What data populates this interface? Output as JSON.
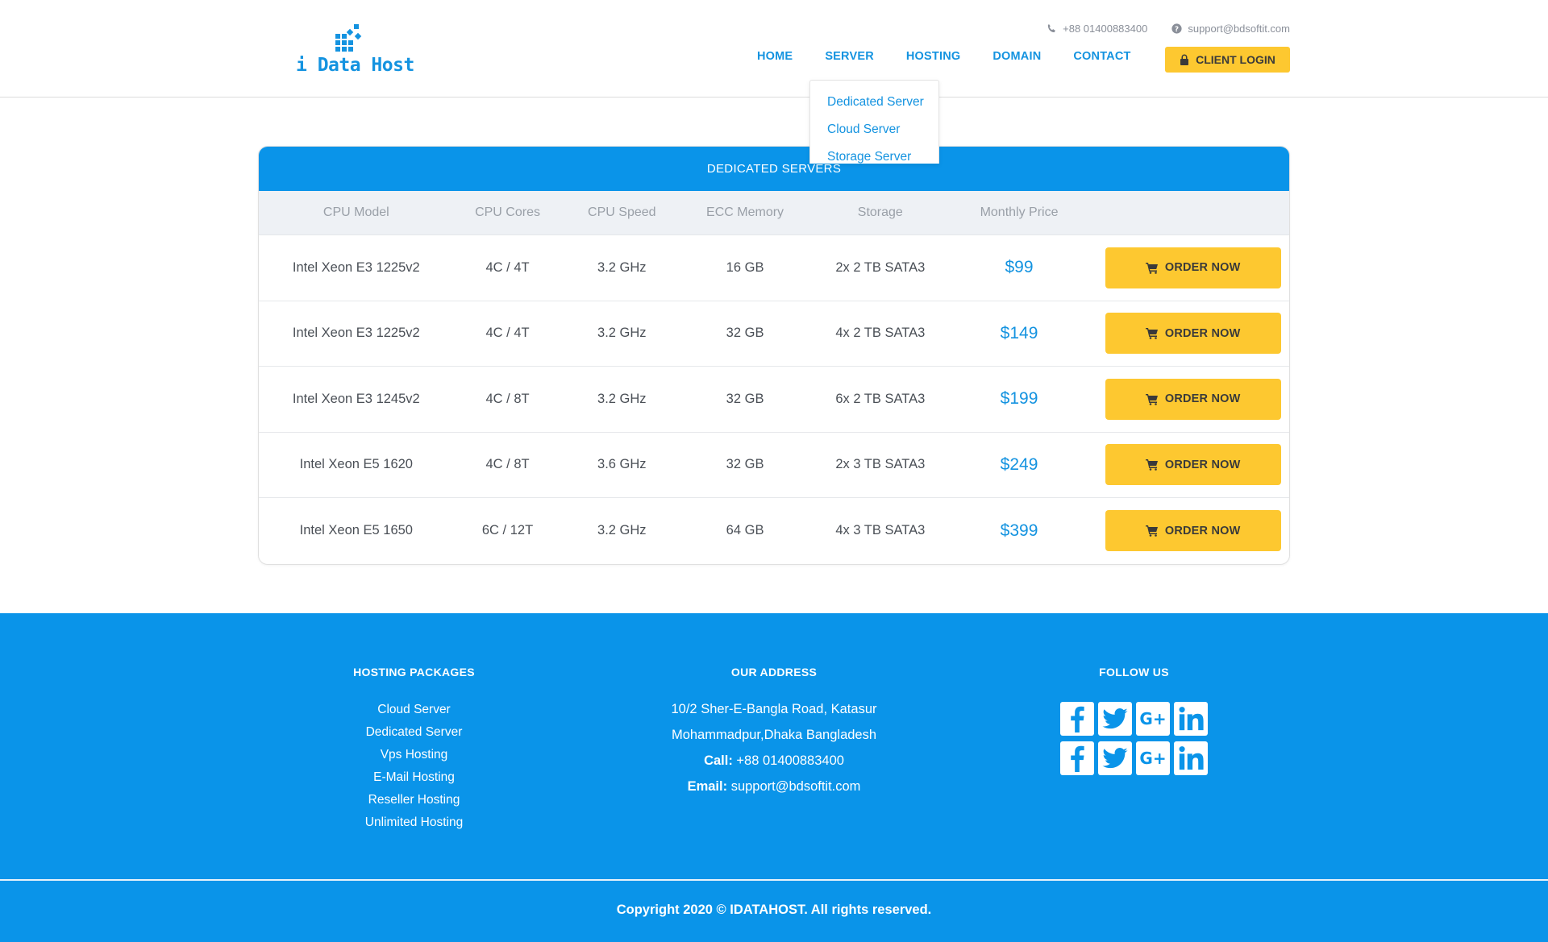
{
  "brand": {
    "name": "i Data Host"
  },
  "topbar": {
    "phone": "+88 01400883400",
    "email": "support@bdsoftit.com"
  },
  "nav": {
    "home": "HOME",
    "server": "SERVER",
    "hosting": "HOSTING",
    "domain": "DOMAIN",
    "contact": "CONTACT",
    "login": "CLIENT LOGIN"
  },
  "server_menu": [
    "Dedicated Server",
    "Cloud Server",
    "Storage Server"
  ],
  "table": {
    "title": "DEDICATED SERVERS",
    "headers": [
      "CPU Model",
      "CPU Cores",
      "CPU Speed",
      "ECC Memory",
      "Storage",
      "Monthly Price"
    ],
    "order_label": "ORDER NOW",
    "rows": [
      {
        "cpu": "Intel Xeon E3 1225v2",
        "cores": "4C / 4T",
        "speed": "3.2 GHz",
        "memory": "16 GB",
        "storage": "2x 2 TB SATA3",
        "price": "$99"
      },
      {
        "cpu": "Intel Xeon E3 1225v2",
        "cores": "4C / 4T",
        "speed": "3.2 GHz",
        "memory": "32 GB",
        "storage": "4x 2 TB SATA3",
        "price": "$149"
      },
      {
        "cpu": "Intel Xeon E3 1245v2",
        "cores": "4C / 8T",
        "speed": "3.2 GHz",
        "memory": "32 GB",
        "storage": "6x 2 TB SATA3",
        "price": "$199"
      },
      {
        "cpu": "Intel Xeon E5 1620",
        "cores": "4C / 8T",
        "speed": "3.6 GHz",
        "memory": "32 GB",
        "storage": "2x 3 TB SATA3",
        "price": "$249"
      },
      {
        "cpu": "Intel Xeon E5 1650",
        "cores": "6C / 12T",
        "speed": "3.2 GHz",
        "memory": "64 GB",
        "storage": "4x 3 TB SATA3",
        "price": "$399"
      }
    ]
  },
  "footer": {
    "packages_title": "HOSTING PACKAGES",
    "packages": [
      "Cloud Server",
      "Dedicated Server",
      "Vps Hosting",
      "E-Mail Hosting",
      "Reseller Hosting",
      "Unlimited Hosting"
    ],
    "address_title": "OUR ADDRESS",
    "address_line1": "10/2 Sher-E-Bangla Road, Katasur",
    "address_line2": "Mohammadpur,Dhaka Bangladesh",
    "call_label": "Call:",
    "call_value": "+88 01400883400",
    "email_label": "Email:",
    "email_value": "support@bdsoftit.com",
    "follow_title": "FOLLOW US",
    "social_icons": [
      "facebook-icon",
      "twitter-icon",
      "google-plus-icon",
      "linkedin-icon"
    ],
    "copyright": "Copyright 2020 © IDATAHOST. All rights reserved."
  },
  "colors": {
    "primary": "#0a94e9",
    "accent": "#fdc830",
    "link": "#1493e0"
  }
}
